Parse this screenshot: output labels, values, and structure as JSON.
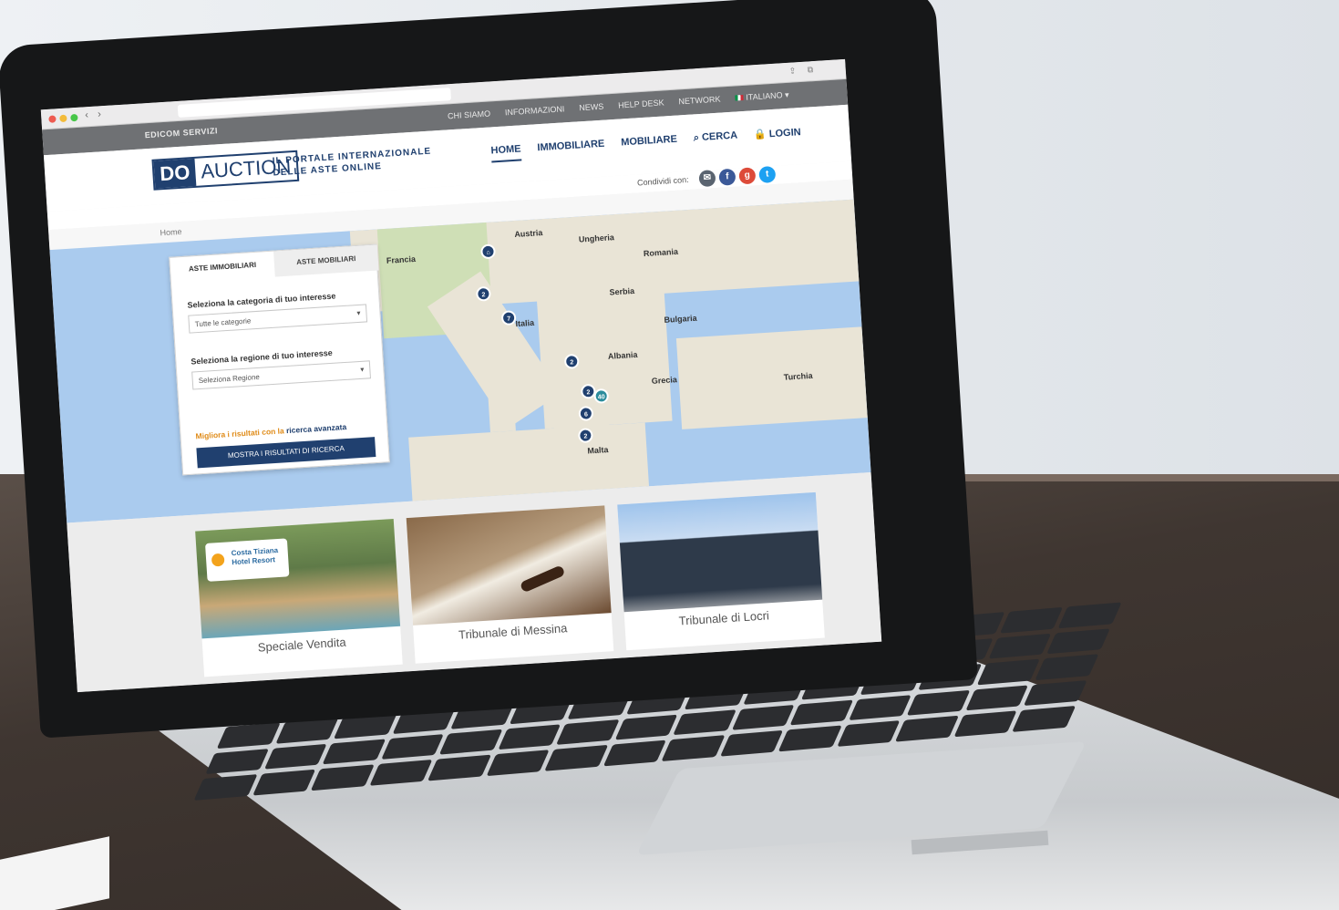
{
  "browser": {
    "url": ""
  },
  "topbar": {
    "brand": "EDICOM SERVIZI",
    "links": [
      "CHI SIAMO",
      "INFORMAZIONI",
      "NEWS",
      "HELP DESK",
      "NETWORK",
      "ITALIANO"
    ]
  },
  "header": {
    "logo_do": "DO",
    "logo_auction": "AUCTION",
    "tagline_line1": "IL PORTALE INTERNAZIONALE",
    "tagline_line2": "DELLE ASTE ONLINE",
    "nav": [
      "HOME",
      "IMMOBILIARE",
      "MOBILIARE",
      "CERCA",
      "LOGIN"
    ]
  },
  "share": {
    "label": "Condividi con:"
  },
  "breadcrumb": "Home",
  "map": {
    "labels": [
      "Francia",
      "Austria",
      "Ungheria",
      "Romania",
      "Italia",
      "Serbia",
      "Bulgaria",
      "Grecia",
      "Turchia",
      "Albania",
      "Malta"
    ],
    "pins": [
      "2",
      "7",
      "2",
      "2",
      "40",
      "6",
      "2"
    ]
  },
  "search_panel": {
    "tab_immobiliari": "ASTE IMMOBILIARI",
    "tab_mobiliari": "ASTE MOBILIARI",
    "category_label": "Seleziona la categoria di tuo interesse",
    "category_value": "Tutte le categorie",
    "region_label": "Seleziona la regione di tuo interesse",
    "region_value": "Seleziona Regione",
    "advanced_prefix": "Migliora i risultati con la",
    "advanced_link": "ricerca avanzata",
    "submit": "MOSTRA I RISULTATI DI RICERCA"
  },
  "cards": [
    {
      "caption": "Speciale Vendita",
      "logo_text": "Costa Tiziana Hotel Resort"
    },
    {
      "caption": "Tribunale di Messina"
    },
    {
      "caption": "Tribunale di Locri"
    }
  ],
  "colors": {
    "brand": "#20406f",
    "accent": "#e08c1a",
    "pin": "#20406f"
  }
}
